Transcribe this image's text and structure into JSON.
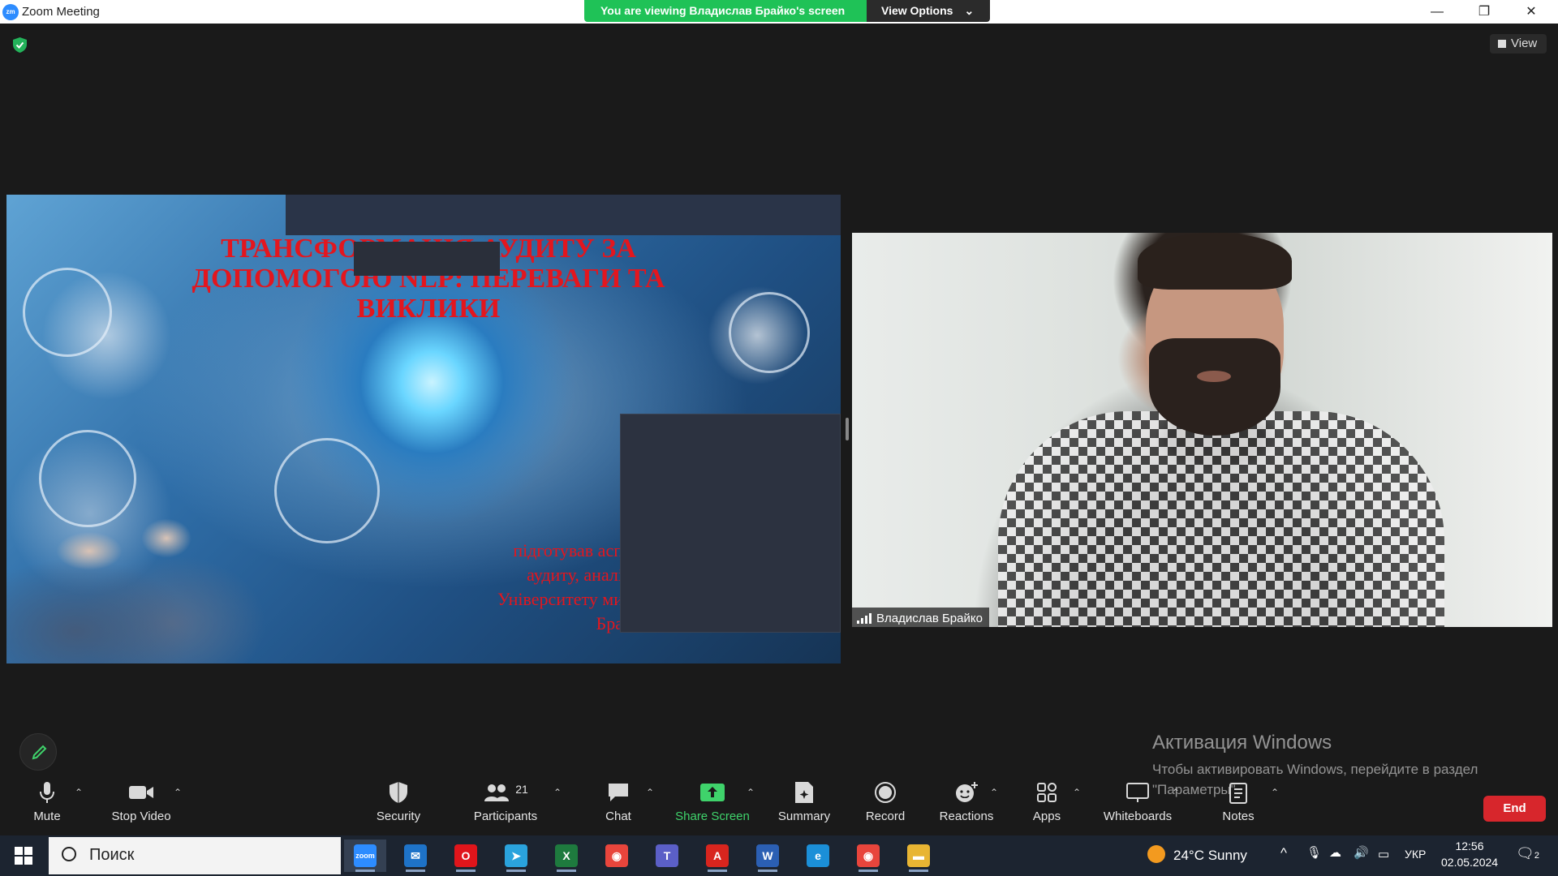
{
  "window": {
    "app_icon_text": "zm",
    "title": "Zoom Meeting",
    "viewing_banner": "You are viewing Владислав Брайко's screen",
    "view_options": "View Options",
    "minimize": "—",
    "restore": "❐",
    "close": "✕"
  },
  "meeting": {
    "view_button": "View",
    "slide": {
      "title": "ТРАНСФОРМАЦІЯ АУДИТУ ЗА ДОПОМОГОЮ NLP: ПЕРЕВАГИ ТА ВИКЛИКИ",
      "subtitle_lines": [
        "підготував асп",
        "аудиту, аналі",
        "Університету ми",
        "Бра"
      ]
    },
    "participant_name": "Владислав Брайко",
    "watermark": {
      "line1": "Активация Windows",
      "line2": "Чтобы активировать Windows, перейдите в раздел \"Параметры\"."
    }
  },
  "toolbar": {
    "mute": "Mute",
    "stop_video": "Stop Video",
    "security": "Security",
    "participants": "Participants",
    "participants_count": "21",
    "chat": "Chat",
    "share_screen": "Share Screen",
    "summary": "Summary",
    "record": "Record",
    "reactions": "Reactions",
    "apps": "Apps",
    "whiteboards": "Whiteboards",
    "notes": "Notes",
    "end": "End",
    "colors": {
      "share_green": "#3fd36b",
      "end_red": "#d7262c",
      "banner_green": "#1fc257"
    }
  },
  "taskbar": {
    "search_placeholder": "Поиск",
    "weather": "24°C  Sunny",
    "language": "УКР",
    "time": "12:56",
    "date": "02.05.2024",
    "notification_count": "2",
    "apps": [
      {
        "name": "zoom",
        "label": "zoom",
        "color": "#2d8cff"
      },
      {
        "name": "mail",
        "label": "✉",
        "color": "#1e73c8"
      },
      {
        "name": "opera",
        "label": "O",
        "color": "#e0151b"
      },
      {
        "name": "telegram",
        "label": "➤",
        "color": "#2aa3dd"
      },
      {
        "name": "excel",
        "label": "X",
        "color": "#1e7a3e"
      },
      {
        "name": "chrome",
        "label": "◉",
        "color": "#e8453c"
      },
      {
        "name": "teams",
        "label": "T",
        "color": "#5b5fc7"
      },
      {
        "name": "acrobat",
        "label": "A",
        "color": "#d8251e"
      },
      {
        "name": "word",
        "label": "W",
        "color": "#2b5fb3"
      },
      {
        "name": "edge",
        "label": "e",
        "color": "#1b8fd8"
      },
      {
        "name": "chrome-2",
        "label": "◉",
        "color": "#e8453c"
      },
      {
        "name": "explorer",
        "label": "▬",
        "color": "#e8b533"
      }
    ]
  }
}
